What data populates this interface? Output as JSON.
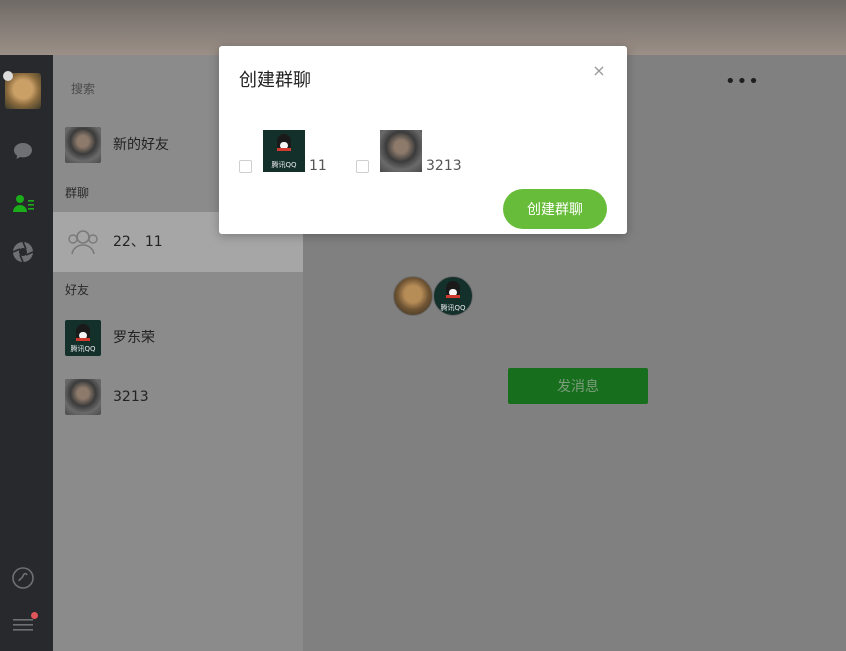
{
  "search": {
    "placeholder": "搜索"
  },
  "contacts": {
    "new_friends_label": "新的好友",
    "section_group": "群聊",
    "group_name": "22、11",
    "section_friends": "好友",
    "friends": [
      {
        "name": "罗东荣",
        "avatar": "qq-penguin-avatar"
      },
      {
        "name": "3213",
        "avatar": "portrait-avatar"
      }
    ]
  },
  "main": {
    "more_label": "•••",
    "send_button_label": "发消息"
  },
  "modal": {
    "title": "创建群聊",
    "close_label": "×",
    "candidates": [
      {
        "label": "11",
        "avatar": "qq-penguin-avatar",
        "checked": false
      },
      {
        "label": "3213",
        "avatar": "portrait-avatar",
        "checked": false
      }
    ],
    "create_button_label": "创建群聊",
    "qq_brand_text": "腾讯QQ"
  },
  "colors": {
    "accent_green": "#67bd3a",
    "send_button": "#176e1c",
    "sidebar": "#28292c",
    "badge_red": "#e0555a"
  }
}
